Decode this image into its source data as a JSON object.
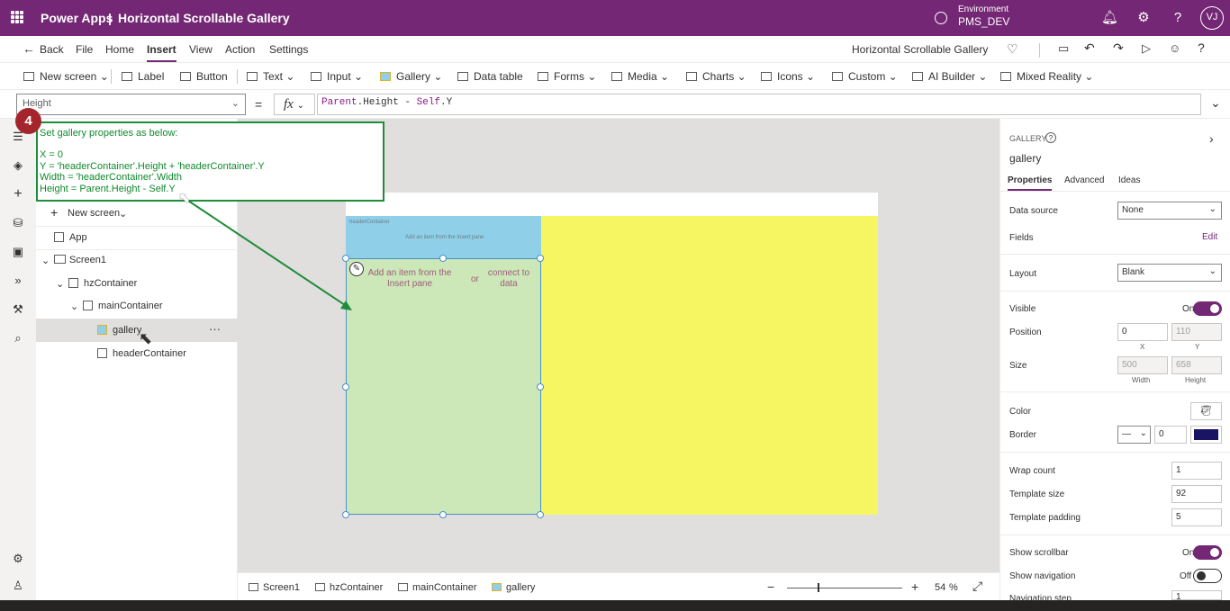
{
  "topbar": {
    "app": "Power Apps",
    "sep": "|",
    "title": "Horizontal Scrollable Gallery",
    "env_label": "Environment",
    "env_value": "PMS_DEV",
    "user_initials": "VJ"
  },
  "menu": {
    "back": "Back",
    "items": [
      "File",
      "Home",
      "Insert",
      "View",
      "Action",
      "Settings"
    ],
    "active": "Insert",
    "app_name": "Horizontal Scrollable Gallery"
  },
  "toolbar": {
    "items": [
      "New screen",
      "Label",
      "Button",
      "Text",
      "Input",
      "Gallery",
      "Data table",
      "Forms",
      "Media",
      "Charts",
      "Icons",
      "Custom",
      "AI Builder",
      "Mixed Reality"
    ]
  },
  "formula": {
    "property": "Height",
    "eq": "=",
    "fx": "fx",
    "expr_a": "Parent",
    "expr_b": ".Height - ",
    "expr_c": "Self",
    "expr_d": ".Y"
  },
  "callout": {
    "badge": "4",
    "lines": [
      "Set gallery properties as below:",
      "",
      "X = 0",
      "Y = 'headerContainer'.Height + 'headerContainer'.Y",
      "Width = 'headerContainer'.Width",
      "Height = Parent.Height - Self.Y"
    ]
  },
  "tree": {
    "new_screen": "New screen",
    "app": "App",
    "screen1": "Screen1",
    "hz": "hzContainer",
    "main": "mainContainer",
    "gallery": "gallery",
    "header": "headerContainer",
    "more": "···"
  },
  "canvas": {
    "hdr_label": "headerContainer",
    "hdr_hint": "Add an item from the Insert pane",
    "gal_hint1": "Add an item from the Insert pane",
    "gal_or": "or",
    "gal_hint2": "connect to data"
  },
  "status": {
    "crumbs": [
      "Screen1",
      "hzContainer",
      "mainContainer",
      "gallery"
    ],
    "zoom": "54",
    "pct": "%"
  },
  "panel": {
    "type": "GALLERY",
    "name": "gallery",
    "tabs": [
      "Properties",
      "Advanced",
      "Ideas"
    ],
    "data_source_label": "Data source",
    "data_source": "None",
    "fields_label": "Fields",
    "fields_edit": "Edit",
    "layout_label": "Layout",
    "layout": "Blank",
    "visible_label": "Visible",
    "visible": "On",
    "position_label": "Position",
    "pos_x": "0",
    "pos_y": "110",
    "x": "X",
    "y": "Y",
    "size_label": "Size",
    "width": "500",
    "height": "658",
    "w": "Width",
    "h": "Height",
    "color_label": "Color",
    "border_label": "Border",
    "border_width": "0",
    "border_color": "#1a1464",
    "wrap_label": "Wrap count",
    "wrap": "1",
    "tsize_label": "Template size",
    "tsize": "92",
    "tpad_label": "Template padding",
    "tpad": "5",
    "scroll_label": "Show scrollbar",
    "scroll": "On",
    "nav_label": "Show navigation",
    "nav": "Off",
    "navstep_label": "Navigation step",
    "navstep": "1"
  }
}
